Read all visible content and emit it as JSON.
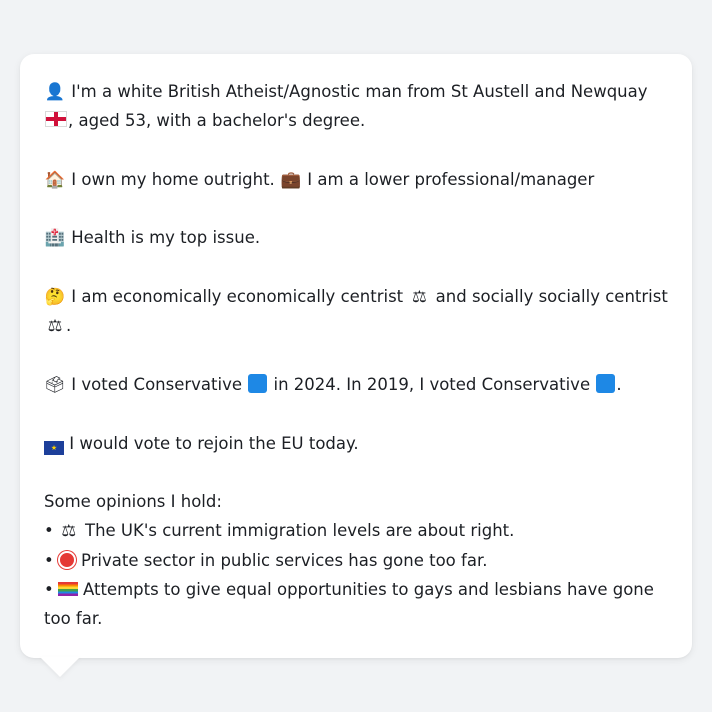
{
  "profile": {
    "identity_text_1": "I'm a white British Atheist/Agnostic man from St Austell and Newquay",
    "identity_text_2": ", aged 53, with a bachelor's degree.",
    "home_text": "I own my home outright.",
    "job_text": "I am a lower professional/manager",
    "issue_text": "Health is my top issue.",
    "stance_text_1": "I am economically economically centrist",
    "stance_text_2": "and socially socially centrist",
    "stance_text_3": ".",
    "vote_text_1": "I voted Conservative",
    "vote_text_2": "in 2024. In 2019, I voted Conservative",
    "vote_text_3": ".",
    "eu_text": "I would vote to rejoin the EU today."
  },
  "opinions": {
    "heading": "Some opinions I hold:",
    "bullet": "•",
    "items": [
      "The UK's current immigration levels are about right.",
      "Private sector in public services has gone too far.",
      "Attempts to give equal opportunities to gays and lesbians have gone too far."
    ]
  },
  "icons": {
    "person": "👤",
    "house": "🏠",
    "briefcase": "💼",
    "hospital": "🏥",
    "thinking": "🤔",
    "scales": "⚖",
    "ballot": "🗳",
    "eu_stars": "★"
  }
}
